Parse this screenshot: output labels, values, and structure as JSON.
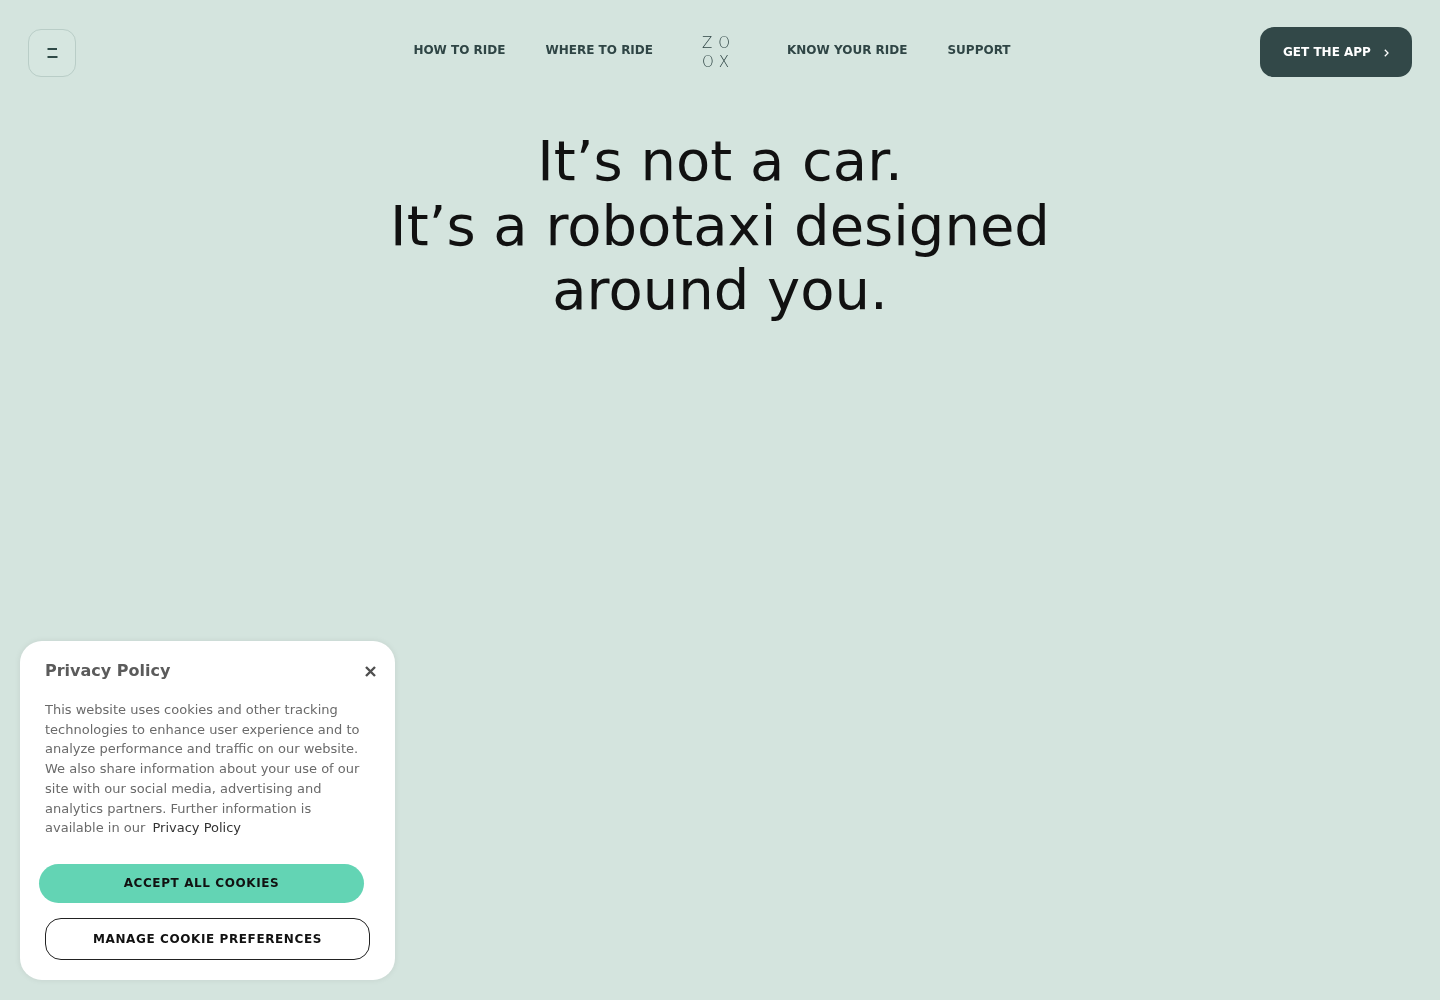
{
  "header": {
    "left_links": [
      "HOW TO RIDE",
      "WHERE TO RIDE"
    ],
    "logo": "ZOOX",
    "right_links": [
      "KNOW YOUR RIDE",
      "SUPPORT"
    ],
    "cta_button": "GET THE APP"
  },
  "hero": {
    "title_lines": [
      "It’s not a car.",
      "It’s a robotaxi designed around you."
    ]
  },
  "cookie_banner": {
    "title": "Privacy Policy",
    "text": "This website uses cookies and other tracking technologies to enhance user experience and to analyze performance and traffic on our website. We also share information about your use of our site with our social media, advertising and analytics partners. Further information is available in our",
    "link": "Privacy Policy",
    "buttons": [
      {
        "label": "ACCEPT ALL COOKIES",
        "kind": "primary"
      },
      {
        "label": "MANAGE COOKIE PREFERENCES",
        "kind": "outline"
      }
    ]
  }
}
